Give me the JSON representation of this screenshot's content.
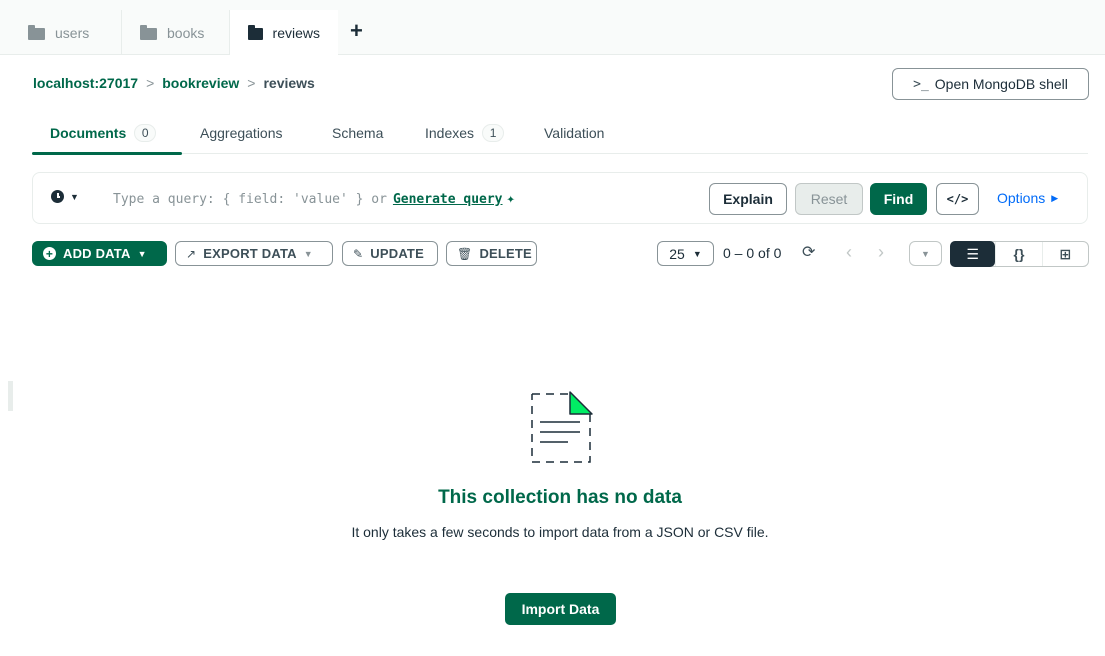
{
  "collection_tabs": [
    {
      "label": "users",
      "active": false
    },
    {
      "label": "books",
      "active": false
    },
    {
      "label": "reviews",
      "active": true
    }
  ],
  "new_tab_symbol": "+",
  "breadcrumb": {
    "host": "localhost:27017",
    "database": "bookreview",
    "collection": "reviews",
    "separator": ">"
  },
  "shell_button": {
    "glyph": ">_",
    "label": "Open MongoDB shell"
  },
  "sub_tabs": {
    "documents": {
      "label": "Documents",
      "count": "0"
    },
    "aggregations": {
      "label": "Aggregations"
    },
    "schema": {
      "label": "Schema"
    },
    "indexes": {
      "label": "Indexes",
      "count": "1"
    },
    "validation": {
      "label": "Validation"
    }
  },
  "query_bar": {
    "placeholder": "Type a query: { field: 'value' } or",
    "generate_label": "Generate query",
    "explain_label": "Explain",
    "reset_label": "Reset",
    "find_label": "Find",
    "code_label": "</>",
    "options_label": "Options"
  },
  "toolbar": {
    "add_data_label": "ADD DATA",
    "export_data_label": "EXPORT DATA",
    "update_label": "UPDATE",
    "delete_label": "DELETE",
    "page_size": "25",
    "range_text": "0 – 0 of 0"
  },
  "empty_state": {
    "title": "This collection has no data",
    "description": "It only takes a few seconds to import data from a JSON or CSV file.",
    "import_label": "Import Data"
  },
  "colors": {
    "accent_green": "#00684a",
    "link_blue": "#016bf8",
    "icon_green": "#00ed64",
    "text_dark": "#1c2d38"
  }
}
